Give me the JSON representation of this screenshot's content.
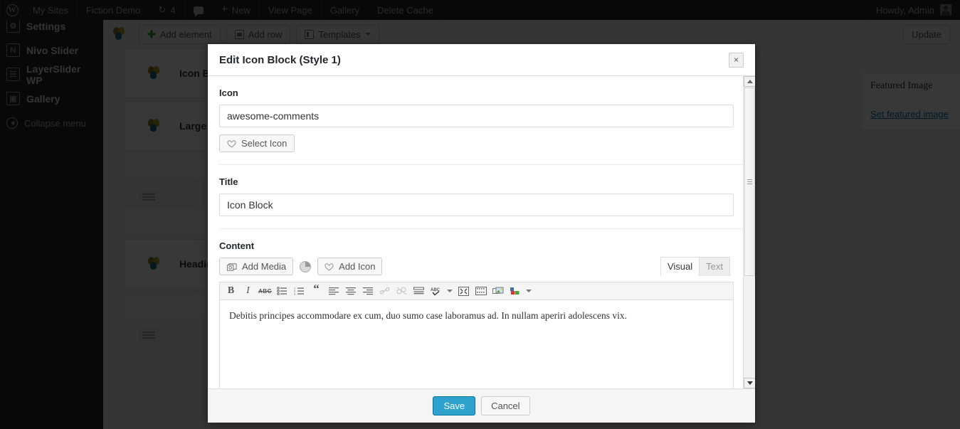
{
  "adminbar": {
    "logo_icon": "wordpress-logo-icon",
    "items": [
      {
        "label": "My Sites",
        "icon": null
      },
      {
        "label": "Fiction Demo",
        "icon": null
      },
      {
        "label": "4",
        "icon": "refresh-icon"
      },
      {
        "label": "",
        "icon": "comment-icon"
      },
      {
        "label": "New",
        "icon": "plus-icon"
      },
      {
        "label": "View Page",
        "icon": null
      },
      {
        "label": "Gallery",
        "icon": null
      },
      {
        "label": "Delete Cache",
        "icon": null
      }
    ],
    "account": {
      "label": "Howdy, Admin",
      "avatar_icon": "user-avatar-icon"
    }
  },
  "vcbar": {
    "logo_icon": "visual-composer-logo-icon",
    "add_element": "Add element",
    "add_row": "Add row",
    "templates": "Templates",
    "update": "Update"
  },
  "sidebar": {
    "items": [
      {
        "label": "Settings",
        "icon_letter": "⚙"
      },
      {
        "label": "Nivo Slider",
        "icon_letter": "N"
      },
      {
        "label": "LayerSlider WP",
        "icon_letter": "☰"
      },
      {
        "label": "Gallery",
        "icon_letter": "▣"
      }
    ],
    "collapse": "Collapse menu"
  },
  "background": {
    "elements": [
      {
        "label": "Icon Bl"
      },
      {
        "label": "Large S"
      },
      {
        "label": "Headin"
      }
    ],
    "featured_box": {
      "title": "Featured Image",
      "link": "Set featured image"
    }
  },
  "modal": {
    "title": "Edit Icon Block (Style 1)",
    "close_label": "×",
    "icon_section": {
      "label": "Icon",
      "value": "awesome-comments",
      "placeholder": "",
      "select_button": "Select Icon"
    },
    "title_section": {
      "label": "Title",
      "value": "Icon Block",
      "placeholder": ""
    },
    "content_section": {
      "label": "Content",
      "add_media": "Add Media",
      "add_icon": "Add Icon",
      "pie_icon": "pie-chart-icon",
      "tabs": [
        {
          "label": "Visual",
          "active": true
        },
        {
          "label": "Text",
          "active": false
        }
      ],
      "toolbar": [
        {
          "name": "bold",
          "glyph": "B"
        },
        {
          "name": "italic",
          "glyph": "I"
        },
        {
          "name": "strikethrough",
          "glyph": "ABC"
        },
        {
          "name": "bullet-list",
          "glyph": ""
        },
        {
          "name": "numbered-list",
          "glyph": ""
        },
        {
          "name": "blockquote",
          "glyph": "“"
        },
        {
          "name": "align-left",
          "glyph": ""
        },
        {
          "name": "align-center",
          "glyph": ""
        },
        {
          "name": "align-right",
          "glyph": ""
        },
        {
          "name": "insert-link",
          "glyph": ""
        },
        {
          "name": "unlink",
          "glyph": ""
        },
        {
          "name": "insert-more",
          "glyph": ""
        },
        {
          "name": "spellcheck",
          "glyph": "ABC"
        },
        {
          "name": "fullscreen",
          "glyph": ""
        },
        {
          "name": "kitchen-sink",
          "glyph": ""
        },
        {
          "name": "insert-image",
          "glyph": ""
        },
        {
          "name": "text-color",
          "glyph": ""
        }
      ],
      "body_text": "Debitis principes accommodare ex cum, duo sumo case laboramus ad. In nullam aperiri adolescens vix."
    },
    "footer": {
      "save": "Save",
      "cancel": "Cancel"
    }
  },
  "colors": {
    "adminbar_bg": "#23282d",
    "sidebar_bg": "#23282d",
    "page_bg": "#f1f1f1",
    "primary_button": "#2ea2cc",
    "link": "#0073aa",
    "modal_bg": "#ffffff"
  }
}
